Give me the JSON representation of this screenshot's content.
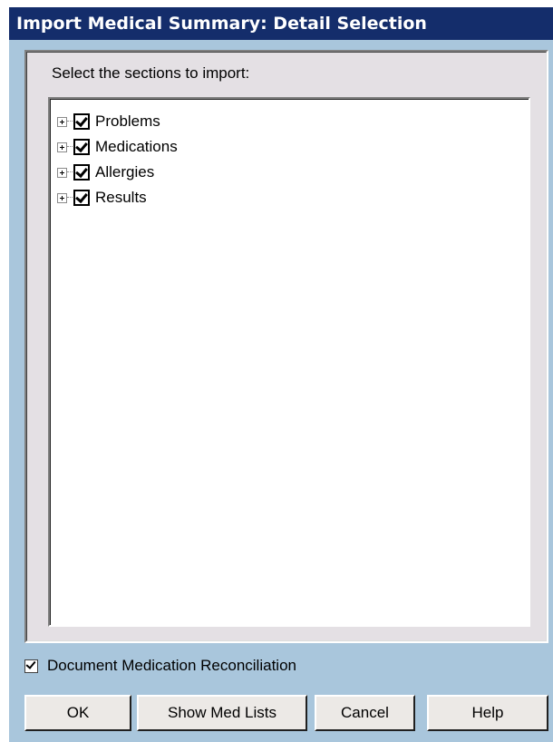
{
  "window": {
    "title": "Import Medical Summary: Detail Selection"
  },
  "panel": {
    "instruction": "Select the sections to import:"
  },
  "tree": {
    "items": [
      {
        "label": "Problems",
        "checked": true,
        "expanded": false
      },
      {
        "label": "Medications",
        "checked": true,
        "expanded": false
      },
      {
        "label": "Allergies",
        "checked": true,
        "expanded": false
      },
      {
        "label": "Results",
        "checked": true,
        "expanded": false
      }
    ]
  },
  "reconciliation": {
    "label": "Document Medication Reconciliation",
    "checked": true
  },
  "buttons": {
    "ok": "OK",
    "show_med_lists": "Show Med Lists",
    "cancel": "Cancel",
    "help": "Help"
  },
  "colors": {
    "title_bar": "#142d6b",
    "title_text": "#ffffff",
    "window_bg": "#a9c6dc",
    "panel_bg": "#e4e0e4",
    "button_bg": "#ece9e6"
  }
}
